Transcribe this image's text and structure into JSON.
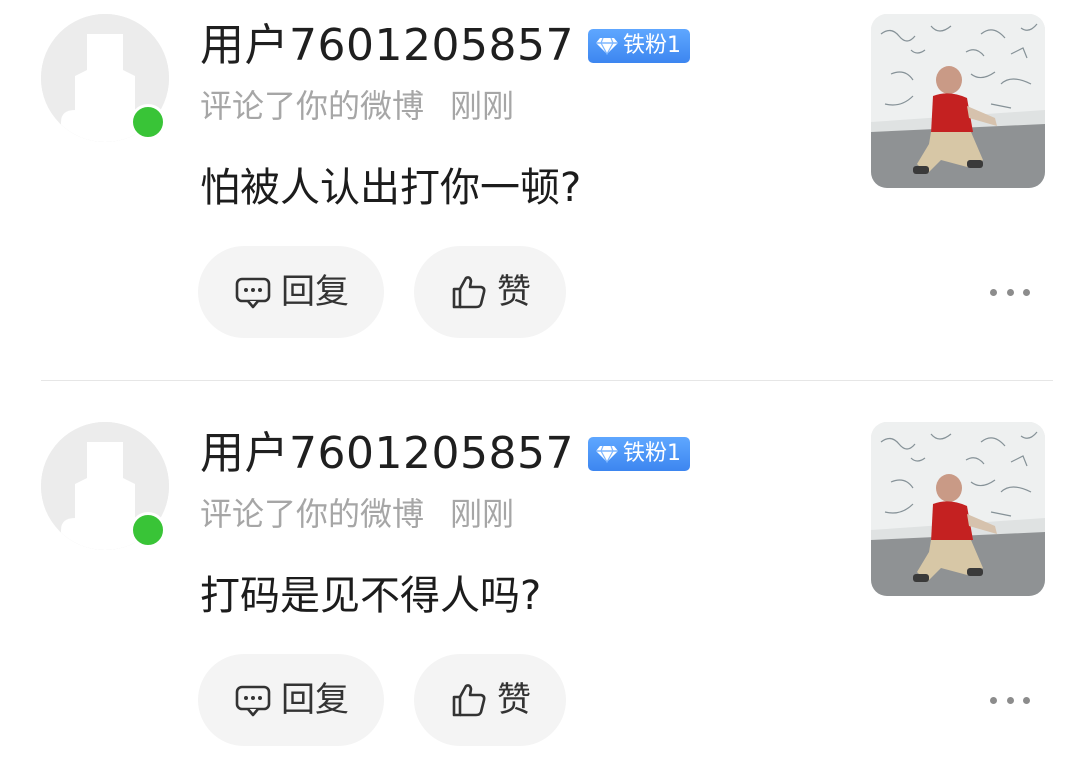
{
  "notifications": [
    {
      "username": "用户7601205857",
      "badge": "铁粉1",
      "action": "评论了你的微博",
      "time": "刚刚",
      "comment": "怕被人认出打你一顿?",
      "reply_label": "回复",
      "like_label": "赞",
      "online": true
    },
    {
      "username": "用户7601205857",
      "badge": "铁粉1",
      "action": "评论了你的微博",
      "time": "刚刚",
      "comment": "打码是见不得人吗?",
      "reply_label": "回复",
      "like_label": "赞",
      "online": true
    }
  ],
  "icons": {
    "reply": "comment-bubble-icon",
    "like": "thumbs-up-icon",
    "more": "more-dots-icon",
    "badge": "diamond-icon"
  },
  "colors": {
    "online": "#39c437",
    "badge": "#4a90f2",
    "meta_text": "#a6a6a6",
    "pill_bg": "#f4f4f4"
  }
}
